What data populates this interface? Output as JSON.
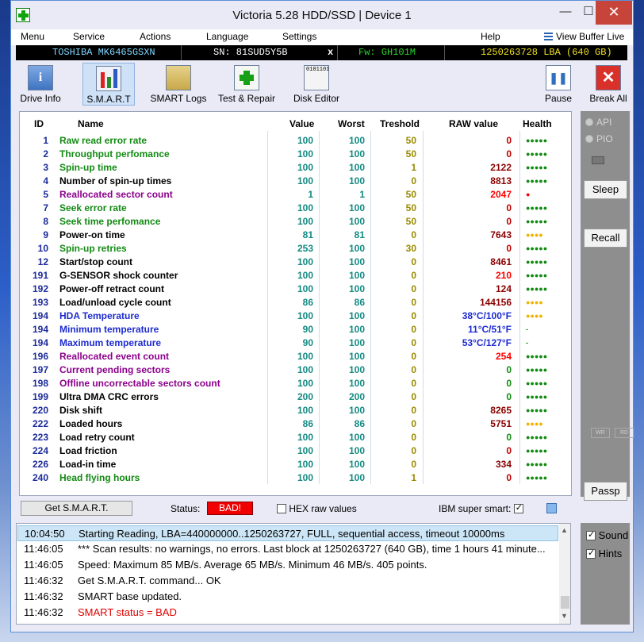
{
  "window": {
    "title": "Victoria 5.28 HDD/SSD | Device 1"
  },
  "menu": {
    "items": [
      "Menu",
      "Service",
      "Actions",
      "Language",
      "Settings",
      "Help"
    ],
    "view_buffer": "View Buffer Live"
  },
  "device": {
    "model": "TOSHIBA MK6465GSXN",
    "serial": "SN: 81SUD5Y5B",
    "close": "x",
    "firmware": "Fw: GH101M",
    "lba": "1250263728 LBA (640 GB)"
  },
  "toolbar": {
    "drive_info": "Drive Info",
    "smart": "S.M.A.R.T",
    "smart_logs": "SMART Logs",
    "test_repair": "Test & Repair",
    "disk_editor": "Disk Editor",
    "pause": "Pause",
    "break_all": "Break All",
    "disk_editor_bits": "01011011010011010"
  },
  "smart": {
    "headers": {
      "id": "ID",
      "name": "Name",
      "value": "Value",
      "worst": "Worst",
      "treshold": "Treshold",
      "raw": "RAW value",
      "health": "Health"
    },
    "rows": [
      {
        "id": "1",
        "name": "Raw read error rate",
        "value": "100",
        "worst": "100",
        "tresh": "50",
        "raw": "0",
        "health": "●●●●●",
        "name_color": "#138a13",
        "raw_color": "#c00000",
        "health_color": "#138a13"
      },
      {
        "id": "2",
        "name": "Throughput perfomance",
        "value": "100",
        "worst": "100",
        "tresh": "50",
        "raw": "0",
        "health": "●●●●●",
        "name_color": "#138a13",
        "raw_color": "#c00000",
        "health_color": "#138a13"
      },
      {
        "id": "3",
        "name": "Spin-up time",
        "value": "100",
        "worst": "100",
        "tresh": "1",
        "raw": "2122",
        "health": "●●●●●",
        "name_color": "#138a13",
        "raw_color": "#8b0000",
        "health_color": "#138a13"
      },
      {
        "id": "4",
        "name": "Number of spin-up times",
        "value": "100",
        "worst": "100",
        "tresh": "0",
        "raw": "8813",
        "health": "●●●●●",
        "name_color": "#000000",
        "raw_color": "#8b0000",
        "health_color": "#138a13"
      },
      {
        "id": "5",
        "name": "Reallocated sector count",
        "value": "1",
        "worst": "1",
        "tresh": "50",
        "raw": "2047",
        "health": "●",
        "name_color": "#8b008b",
        "raw_color": "#ff0000",
        "health_color": "#ff0000"
      },
      {
        "id": "7",
        "name": "Seek error rate",
        "value": "100",
        "worst": "100",
        "tresh": "50",
        "raw": "0",
        "health": "●●●●●",
        "name_color": "#138a13",
        "raw_color": "#c00000",
        "health_color": "#138a13"
      },
      {
        "id": "8",
        "name": "Seek time perfomance",
        "value": "100",
        "worst": "100",
        "tresh": "50",
        "raw": "0",
        "health": "●●●●●",
        "name_color": "#138a13",
        "raw_color": "#c00000",
        "health_color": "#138a13"
      },
      {
        "id": "9",
        "name": "Power-on time",
        "value": "81",
        "worst": "81",
        "tresh": "0",
        "raw": "7643",
        "health": "●●●●",
        "name_color": "#000000",
        "raw_color": "#8b0000",
        "health_color": "#f0b400"
      },
      {
        "id": "10",
        "name": "Spin-up retries",
        "value": "253",
        "worst": "100",
        "tresh": "30",
        "raw": "0",
        "health": "●●●●●",
        "name_color": "#138a13",
        "raw_color": "#c00000",
        "health_color": "#138a13"
      },
      {
        "id": "12",
        "name": "Start/stop count",
        "value": "100",
        "worst": "100",
        "tresh": "0",
        "raw": "8461",
        "health": "●●●●●",
        "name_color": "#000000",
        "raw_color": "#8b0000",
        "health_color": "#138a13"
      },
      {
        "id": "191",
        "name": "G-SENSOR shock counter",
        "value": "100",
        "worst": "100",
        "tresh": "0",
        "raw": "210",
        "health": "●●●●●",
        "name_color": "#000000",
        "raw_color": "#ff0000",
        "health_color": "#138a13"
      },
      {
        "id": "192",
        "name": "Power-off retract count",
        "value": "100",
        "worst": "100",
        "tresh": "0",
        "raw": "124",
        "health": "●●●●●",
        "name_color": "#000000",
        "raw_color": "#8b0000",
        "health_color": "#138a13"
      },
      {
        "id": "193",
        "name": "Load/unload cycle count",
        "value": "86",
        "worst": "86",
        "tresh": "0",
        "raw": "144156",
        "health": "●●●●",
        "name_color": "#000000",
        "raw_color": "#8b0000",
        "health_color": "#f0b400"
      },
      {
        "id": "194",
        "name": "HDA Temperature",
        "value": "100",
        "worst": "100",
        "tresh": "0",
        "raw": "38°C/100°F",
        "health": "●●●●",
        "name_color": "#1c2bd0",
        "raw_color": "#1c2bd0",
        "health_color": "#f0b400"
      },
      {
        "id": "194",
        "name": "Minimum temperature",
        "value": "90",
        "worst": "100",
        "tresh": "0",
        "raw": "11°C/51°F",
        "health": "-",
        "name_color": "#1c2bd0",
        "raw_color": "#1c2bd0",
        "health_color": "#138a13"
      },
      {
        "id": "194",
        "name": "Maximum temperature",
        "value": "90",
        "worst": "100",
        "tresh": "0",
        "raw": "53°C/127°F",
        "health": "-",
        "name_color": "#1c2bd0",
        "raw_color": "#1c2bd0",
        "health_color": "#138a13"
      },
      {
        "id": "196",
        "name": "Reallocated event count",
        "value": "100",
        "worst": "100",
        "tresh": "0",
        "raw": "254",
        "health": "●●●●●",
        "name_color": "#8b008b",
        "raw_color": "#ff0000",
        "health_color": "#138a13"
      },
      {
        "id": "197",
        "name": "Current pending sectors",
        "value": "100",
        "worst": "100",
        "tresh": "0",
        "raw": "0",
        "health": "●●●●●",
        "name_color": "#8b008b",
        "raw_color": "#138a13",
        "health_color": "#138a13"
      },
      {
        "id": "198",
        "name": "Offline uncorrectable sectors count",
        "value": "100",
        "worst": "100",
        "tresh": "0",
        "raw": "0",
        "health": "●●●●●",
        "name_color": "#8b008b",
        "raw_color": "#138a13",
        "health_color": "#138a13"
      },
      {
        "id": "199",
        "name": "Ultra DMA CRC errors",
        "value": "200",
        "worst": "200",
        "tresh": "0",
        "raw": "0",
        "health": "●●●●●",
        "name_color": "#000000",
        "raw_color": "#138a13",
        "health_color": "#138a13"
      },
      {
        "id": "220",
        "name": "Disk shift",
        "value": "100",
        "worst": "100",
        "tresh": "0",
        "raw": "8265",
        "health": "●●●●●",
        "name_color": "#000000",
        "raw_color": "#8b0000",
        "health_color": "#138a13"
      },
      {
        "id": "222",
        "name": "Loaded hours",
        "value": "86",
        "worst": "86",
        "tresh": "0",
        "raw": "5751",
        "health": "●●●●",
        "name_color": "#000000",
        "raw_color": "#8b0000",
        "health_color": "#f0b400"
      },
      {
        "id": "223",
        "name": "Load retry count",
        "value": "100",
        "worst": "100",
        "tresh": "0",
        "raw": "0",
        "health": "●●●●●",
        "name_color": "#000000",
        "raw_color": "#138a13",
        "health_color": "#138a13"
      },
      {
        "id": "224",
        "name": "Load friction",
        "value": "100",
        "worst": "100",
        "tresh": "0",
        "raw": "0",
        "health": "●●●●●",
        "name_color": "#000000",
        "raw_color": "#c00000",
        "health_color": "#138a13"
      },
      {
        "id": "226",
        "name": "Load-in time",
        "value": "100",
        "worst": "100",
        "tresh": "0",
        "raw": "334",
        "health": "●●●●●",
        "name_color": "#000000",
        "raw_color": "#8b0000",
        "health_color": "#138a13"
      },
      {
        "id": "240",
        "name": "Head flying hours",
        "value": "100",
        "worst": "100",
        "tresh": "1",
        "raw": "0",
        "health": "●●●●●",
        "name_color": "#138a13",
        "raw_color": "#c00000",
        "health_color": "#138a13"
      }
    ]
  },
  "side": {
    "api": "API",
    "pio": "PIO",
    "sleep": "Sleep",
    "recall": "Recall",
    "wr": "WR",
    "rd": "RD",
    "passp": "Passp"
  },
  "status_bar": {
    "get_smart": "Get S.M.A.R.T.",
    "status_label": "Status:",
    "status_value": "BAD!",
    "hex_raw": "HEX raw values",
    "ibm_smart": "IBM super smart:"
  },
  "log": [
    {
      "time": "10:04:50",
      "msg": "Starting Reading, LBA=440000000..1250263727, FULL, sequential access, timeout 10000ms",
      "color": "#000000"
    },
    {
      "time": "11:46:05",
      "msg": "*** Scan results: no warnings, no errors. Last block at 1250263727 (640 GB), time 1 hours 41 minute...",
      "color": "#000000"
    },
    {
      "time": "11:46:05",
      "msg": "Speed: Maximum 85 MB/s. Average 65 MB/s. Minimum 46 MB/s. 405 points.",
      "color": "#000000"
    },
    {
      "time": "11:46:32",
      "msg": "Get S.M.A.R.T. command... OK",
      "color": "#000000"
    },
    {
      "time": "11:46:32",
      "msg": "SMART base updated.",
      "color": "#000000"
    },
    {
      "time": "11:46:32",
      "msg": "SMART status = BAD",
      "color": "#e00000"
    }
  ],
  "options": {
    "sound": "Sound",
    "hints": "Hints"
  }
}
